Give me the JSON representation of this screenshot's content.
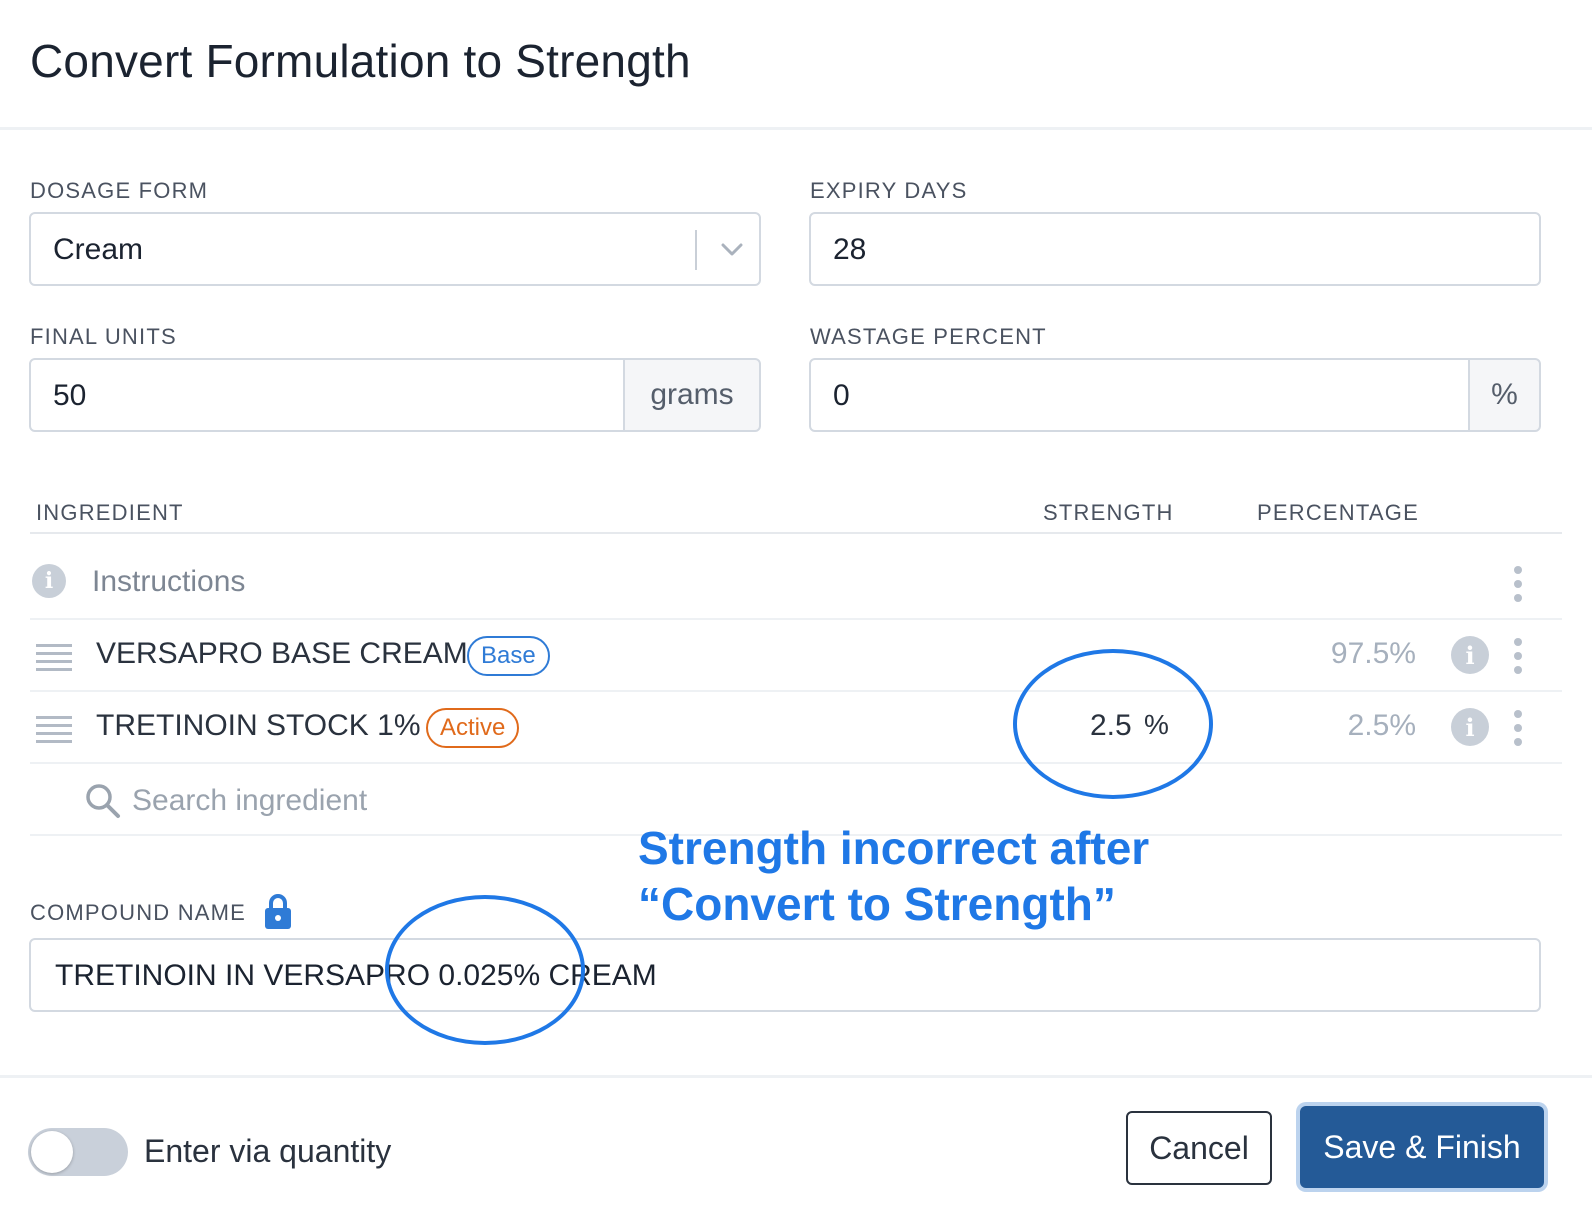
{
  "dialog": {
    "title": "Convert Formulation to Strength"
  },
  "form": {
    "dosage_form": {
      "label": "DOSAGE FORM",
      "value": "Cream"
    },
    "expiry_days": {
      "label": "EXPIRY DAYS",
      "value": "28"
    },
    "final_units": {
      "label": "FINAL UNITS",
      "value": "50",
      "unit": "grams"
    },
    "wastage_percent": {
      "label": "WASTAGE PERCENT",
      "value": "0",
      "unit": "%"
    }
  },
  "table": {
    "headers": {
      "ingredient": "INGREDIENT",
      "strength": "STRENGTH",
      "percentage": "PERCENTAGE"
    },
    "instructions_label": "Instructions",
    "rows": [
      {
        "name": "VERSAPRO BASE CREAM",
        "badge": "Base",
        "strength": "",
        "percentage": "97.5%"
      },
      {
        "name": "TRETINOIN STOCK 1%",
        "badge": "Active",
        "strength": "2.5",
        "strength_unit": "%",
        "percentage": "2.5%"
      }
    ],
    "search_placeholder": "Search ingredient"
  },
  "compound": {
    "label": "COMPOUND NAME",
    "value": "TRETINOIN IN VERSAPRO 0.025% CREAM"
  },
  "annotation": {
    "line1": "Strength incorrect after",
    "line2": "“Convert to Strength”"
  },
  "footer": {
    "toggle_label": "Enter via quantity",
    "toggle_on": false,
    "cancel_label": "Cancel",
    "save_label": "Save & Finish"
  },
  "icons": {
    "info": "info-icon",
    "drag": "drag-handle-icon",
    "kebab": "more-vertical-icon",
    "search": "search-icon",
    "lock": "lock-icon",
    "chevron": "chevron-down-icon"
  },
  "colors": {
    "primary": "#245a97",
    "annotation": "#1f78e6",
    "base_badge": "#2f7bd6",
    "active_badge": "#e06a1b"
  }
}
